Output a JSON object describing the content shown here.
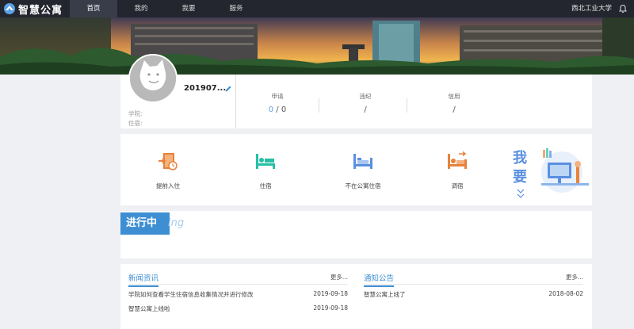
{
  "app": {
    "name": "智慧公寓",
    "school": "西北工业大学"
  },
  "nav": [
    {
      "label": "首页",
      "active": true
    },
    {
      "label": "我的",
      "active": false
    },
    {
      "label": "我要",
      "active": false
    },
    {
      "label": "服务",
      "active": false
    }
  ],
  "profile": {
    "username": "201907...",
    "college_label": "学院:",
    "room_label": "住宿:",
    "stats": {
      "apply": {
        "label": "申请",
        "current": "0",
        "sep": " / ",
        "total": "0"
      },
      "violation": {
        "label": "违纪",
        "value": "/"
      },
      "credit": {
        "label": "信用",
        "value": "/"
      }
    }
  },
  "services": [
    {
      "label": "提前入住",
      "icon": "early-checkin-icon"
    },
    {
      "label": "住宿",
      "icon": "accommodation-bed-icon"
    },
    {
      "label": "不在公寓住宿",
      "icon": "not-staying-bed-icon"
    },
    {
      "label": "调宿",
      "icon": "room-change-bed-icon"
    }
  ],
  "want": {
    "line1": "我",
    "line2": "要"
  },
  "progress": {
    "title": "进行中",
    "suffix": "ing"
  },
  "news": {
    "title": "新闻资讯",
    "more": "更多...",
    "items": [
      {
        "title": "学院如何查看学生住宿信息收集情况并进行修改",
        "date": "2019-09-18"
      },
      {
        "title": "智慧公寓上线啦",
        "date": "2019-09-18"
      }
    ]
  },
  "notices": {
    "title": "通知公告",
    "more": "更多...",
    "items": [
      {
        "title": "智慧公寓上线了",
        "date": "2018-08-02"
      }
    ]
  },
  "colors": {
    "accent": "#3d8ed3",
    "orange": "#e8823a",
    "teal": "#28bfa6",
    "blue": "#5a8fe0",
    "topbar": "#23262e"
  }
}
